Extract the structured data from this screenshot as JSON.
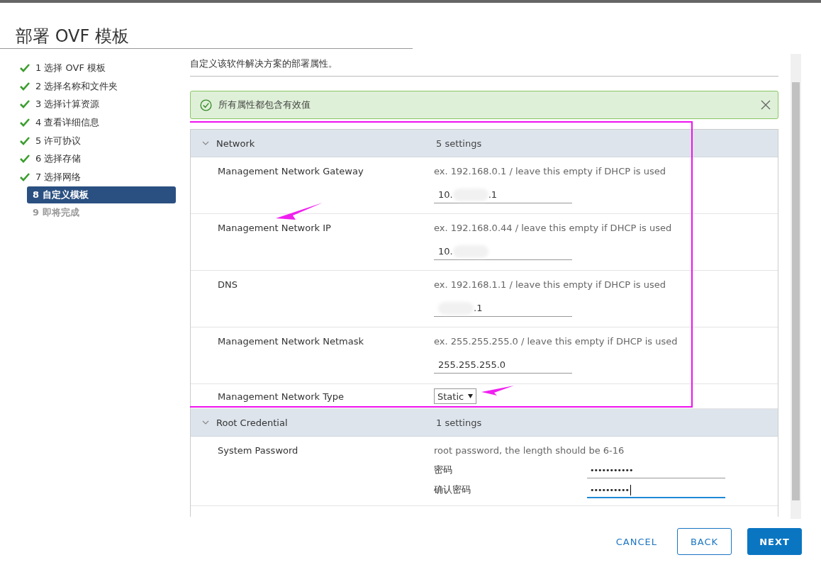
{
  "title": "部署 OVF 模板",
  "steps": [
    {
      "label": "1 选择 OVF 模板",
      "completed": true,
      "selected": false
    },
    {
      "label": "2 选择名称和文件夹",
      "completed": true,
      "selected": false
    },
    {
      "label": "3 选择计算资源",
      "completed": true,
      "selected": false
    },
    {
      "label": "4 查看详细信息",
      "completed": true,
      "selected": false
    },
    {
      "label": "5 许可协议",
      "completed": true,
      "selected": false
    },
    {
      "label": "6 选择存储",
      "completed": true,
      "selected": false
    },
    {
      "label": "7 选择网络",
      "completed": true,
      "selected": false
    },
    {
      "label": "8 自定义模板",
      "completed": false,
      "selected": true
    },
    {
      "label": "9 即将完成",
      "completed": false,
      "selected": false
    }
  ],
  "description": "自定义该软件解决方案的部署属性。",
  "alert": {
    "text": "所有属性都包含有效值"
  },
  "groups": [
    {
      "name": "Network",
      "count": "5 settings",
      "expanded": true,
      "highlighted": true,
      "rows": [
        {
          "kind": "text",
          "label": "Management Network Gateway",
          "hint": "ex. 192.168.0.1 / leave this empty if DHCP is used",
          "value_start": "10.",
          "value_end": ".1",
          "redacted": true
        },
        {
          "kind": "text",
          "label": "Management Network IP",
          "hint": "ex. 192.168.0.44 / leave this empty if DHCP is used",
          "value_start": "10.",
          "redacted": true,
          "arrow": true
        },
        {
          "kind": "text",
          "label": "DNS",
          "hint": "ex. 192.168.1.1 / leave this empty if DHCP is used",
          "value_end": ".1",
          "redacted": true
        },
        {
          "kind": "text",
          "label": "Management Network Netmask",
          "hint": "ex. 255.255.255.0 / leave this empty if DHCP is used",
          "value_start": "255.255.255.0"
        },
        {
          "kind": "select",
          "label": "Management Network Type",
          "value": "Static",
          "arrow": true
        }
      ]
    },
    {
      "name": "Root Credential",
      "count": "1 settings",
      "expanded": true,
      "rows": [
        {
          "kind": "password",
          "label": "System Password",
          "hint": "root password, the length should be 6-16",
          "fields": [
            {
              "label": "密码",
              "value": "•••••••••••",
              "focused": false
            },
            {
              "label": "确认密码",
              "value": "••••••••••",
              "focused": true
            }
          ]
        }
      ]
    }
  ],
  "buttons": [
    {
      "label": "CANCEL",
      "kind": "link"
    },
    {
      "label": "BACK",
      "kind": "secondary"
    },
    {
      "label": "NEXT",
      "kind": "primary"
    }
  ]
}
